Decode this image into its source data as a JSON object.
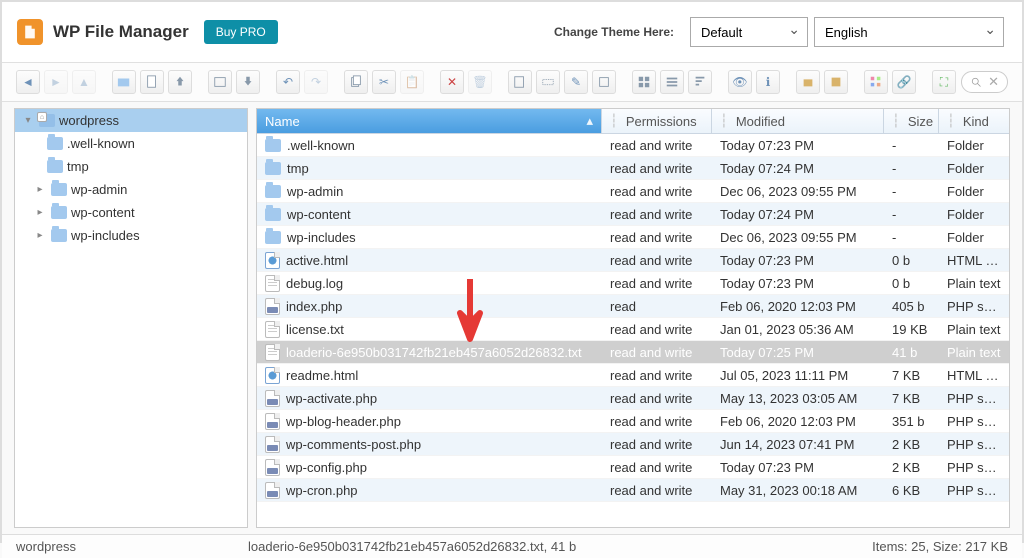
{
  "header": {
    "title": "WP File Manager",
    "buy_pro": "Buy PRO",
    "theme_label": "Change Theme Here:",
    "theme_value": "Default",
    "lang_value": "English"
  },
  "tree": {
    "root": "wordpress",
    "items": [
      {
        "label": ".well-known",
        "expander": ""
      },
      {
        "label": "tmp",
        "expander": ""
      },
      {
        "label": "wp-admin",
        "expander": "▸"
      },
      {
        "label": "wp-content",
        "expander": "▸"
      },
      {
        "label": "wp-includes",
        "expander": "▸"
      }
    ]
  },
  "columns": {
    "name": "Name",
    "perm": "Permissions",
    "mod": "Modified",
    "size": "Size",
    "kind": "Kind"
  },
  "rows": [
    {
      "icon": "folder",
      "name": ".well-known",
      "perm": "read and write",
      "mod": "Today 07:23 PM",
      "size": "-",
      "kind": "Folder"
    },
    {
      "icon": "folder",
      "name": "tmp",
      "perm": "read and write",
      "mod": "Today 07:24 PM",
      "size": "-",
      "kind": "Folder"
    },
    {
      "icon": "folder",
      "name": "wp-admin",
      "perm": "read and write",
      "mod": "Dec 06, 2023 09:55 PM",
      "size": "-",
      "kind": "Folder"
    },
    {
      "icon": "folder",
      "name": "wp-content",
      "perm": "read and write",
      "mod": "Today 07:24 PM",
      "size": "-",
      "kind": "Folder"
    },
    {
      "icon": "folder",
      "name": "wp-includes",
      "perm": "read and write",
      "mod": "Dec 06, 2023 09:55 PM",
      "size": "-",
      "kind": "Folder"
    },
    {
      "icon": "html",
      "name": "active.html",
      "perm": "read and write",
      "mod": "Today 07:23 PM",
      "size": "0 b",
      "kind": "HTML document"
    },
    {
      "icon": "txt",
      "name": "debug.log",
      "perm": "read and write",
      "mod": "Today 07:23 PM",
      "size": "0 b",
      "kind": "Plain text"
    },
    {
      "icon": "php",
      "name": "index.php",
      "perm": "read",
      "mod": "Feb 06, 2020 12:03 PM",
      "size": "405 b",
      "kind": "PHP source"
    },
    {
      "icon": "txt",
      "name": "license.txt",
      "perm": "read and write",
      "mod": "Jan 01, 2023 05:36 AM",
      "size": "19 KB",
      "kind": "Plain text"
    },
    {
      "icon": "txt",
      "name": "loaderio-6e950b031742fb21eb457a6052d26832.txt",
      "perm": "read and write",
      "mod": "Today 07:25 PM",
      "size": "41 b",
      "kind": "Plain text",
      "selected": true
    },
    {
      "icon": "html",
      "name": "readme.html",
      "perm": "read and write",
      "mod": "Jul 05, 2023 11:11 PM",
      "size": "7 KB",
      "kind": "HTML document"
    },
    {
      "icon": "php",
      "name": "wp-activate.php",
      "perm": "read and write",
      "mod": "May 13, 2023 03:05 AM",
      "size": "7 KB",
      "kind": "PHP source"
    },
    {
      "icon": "php",
      "name": "wp-blog-header.php",
      "perm": "read and write",
      "mod": "Feb 06, 2020 12:03 PM",
      "size": "351 b",
      "kind": "PHP source"
    },
    {
      "icon": "php",
      "name": "wp-comments-post.php",
      "perm": "read and write",
      "mod": "Jun 14, 2023 07:41 PM",
      "size": "2 KB",
      "kind": "PHP source"
    },
    {
      "icon": "php",
      "name": "wp-config.php",
      "perm": "read and write",
      "mod": "Today 07:23 PM",
      "size": "2 KB",
      "kind": "PHP source"
    },
    {
      "icon": "php",
      "name": "wp-cron.php",
      "perm": "read and write",
      "mod": "May 31, 2023 00:18 AM",
      "size": "6 KB",
      "kind": "PHP source"
    }
  ],
  "status": {
    "path": "wordpress",
    "selection": "loaderio-6e950b031742fb21eb457a6052d26832.txt, 41 b",
    "summary": "Items: 25, Size: 217 KB"
  }
}
